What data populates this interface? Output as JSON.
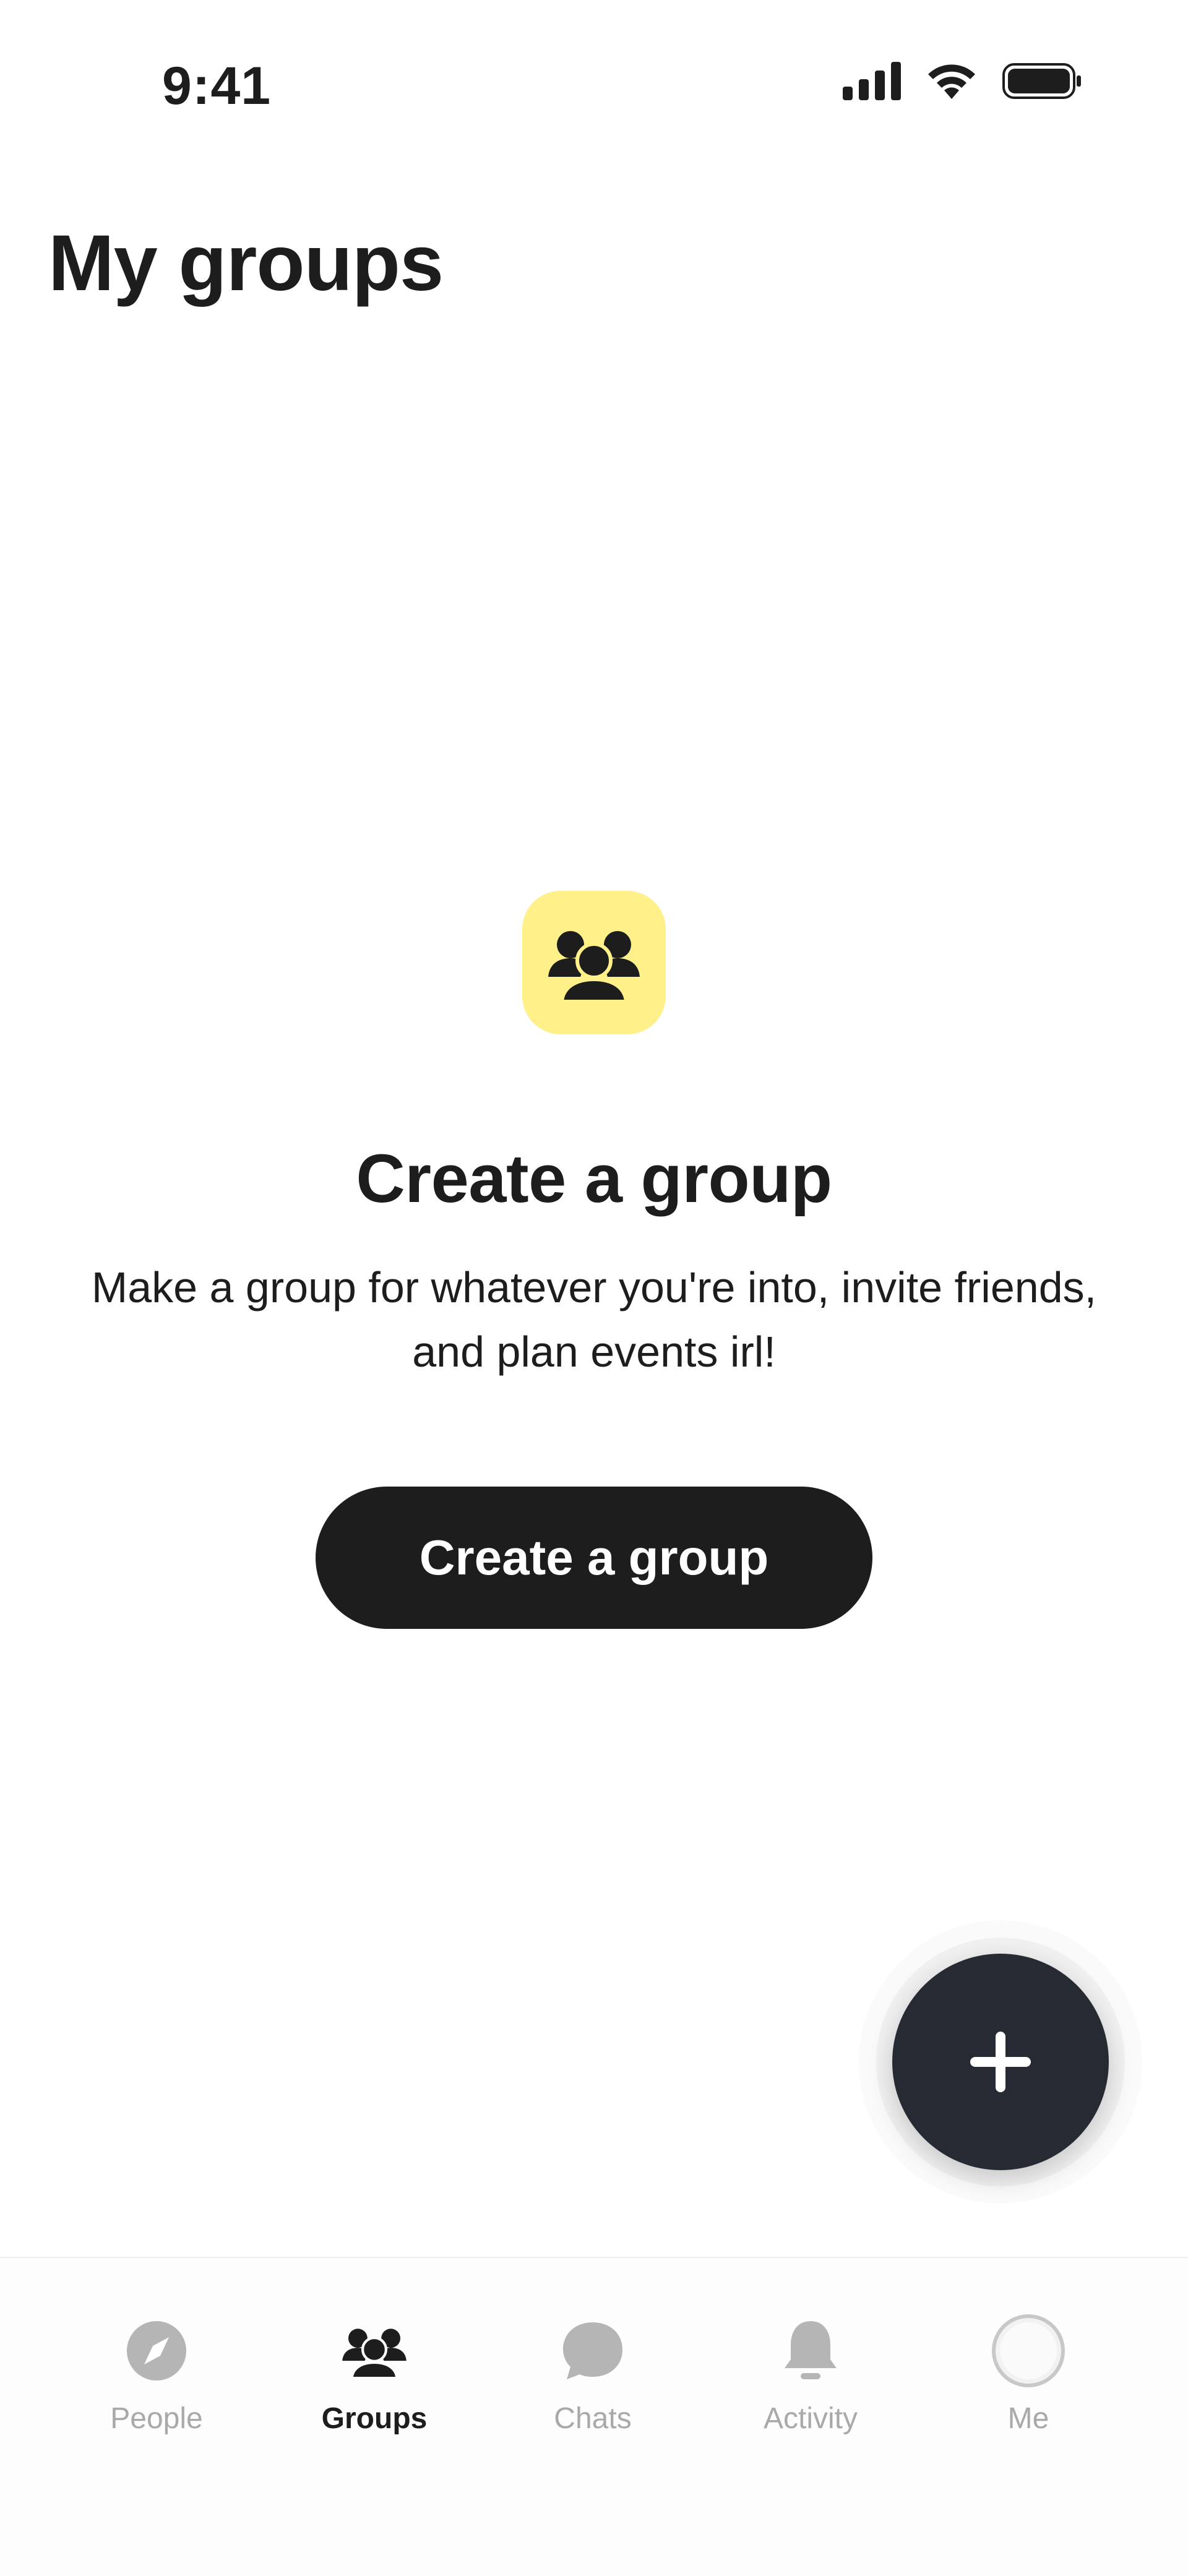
{
  "status_bar": {
    "time": "9:41"
  },
  "page": {
    "title": "My groups"
  },
  "empty_state": {
    "icon": "groups-icon",
    "heading": "Create a group",
    "description": "Make a group for whatever you're into, invite friends, and plan events irl!",
    "button_label": "Create a group"
  },
  "fab": {
    "icon": "plus-icon"
  },
  "tab_bar": {
    "items": [
      {
        "label": "People",
        "icon": "compass-icon",
        "active": false
      },
      {
        "label": "Groups",
        "icon": "groups-icon",
        "active": true
      },
      {
        "label": "Chats",
        "icon": "chat-bubble-icon",
        "active": false
      },
      {
        "label": "Activity",
        "icon": "bell-icon",
        "active": false
      },
      {
        "label": "Me",
        "icon": "avatar-icon",
        "active": false
      }
    ]
  },
  "colors": {
    "accent_tile": "#fff08a",
    "primary_dark": "#1d1d1d",
    "fab_bg": "#262a32",
    "inactive_tab": "#a9a9a9"
  }
}
